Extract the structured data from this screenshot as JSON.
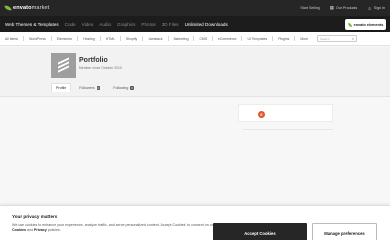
{
  "header": {
    "logo": {
      "name": "envato",
      "suffix": "market"
    },
    "links": [
      {
        "label": "Start Selling",
        "icon": ""
      },
      {
        "label": "Our Products",
        "icon": "grid-icon"
      },
      {
        "label": "Sign In",
        "icon": "user-icon"
      }
    ]
  },
  "categories": [
    "Web Themes & Templates",
    "Code",
    "Video",
    "Audio",
    "Graphics",
    "Photos",
    "3D Files",
    "Unlimited Downloads"
  ],
  "elements_badge": "envato elements",
  "subnav": {
    "items": [
      "All Items",
      "WordPress",
      "Elementor",
      "Hosting",
      "HTML",
      "Shopify",
      "Jamstack",
      "Marketing",
      "CMS",
      "eCommerce",
      "UI Templates",
      "Plugins",
      "More"
    ],
    "search_placeholder": "Search"
  },
  "profile": {
    "username": "Portfolio",
    "member_since": "Member since October 2010",
    "tabs": [
      {
        "label": "Profile",
        "count": ""
      },
      {
        "label": "Followers",
        "count": "0"
      },
      {
        "label": "Following",
        "count": "0"
      }
    ]
  },
  "badge_glyph": "E",
  "cookie": {
    "title": "Your privacy matters",
    "text_part1": "We use cookies to enhance your experience, analyze traffic, and serve personalized content. Accept Cookies' to consent on our",
    "cookies_link": "Cookies",
    "and": " and ",
    "privacy_link": "Privacy",
    "text_part2": " policies.",
    "accept_label": "Accept Cookies",
    "manage_label": "Manage preferences"
  },
  "colors": {
    "brand_green": "#82b440",
    "topbar": "#262626",
    "badge_orange": "#e2562c"
  }
}
